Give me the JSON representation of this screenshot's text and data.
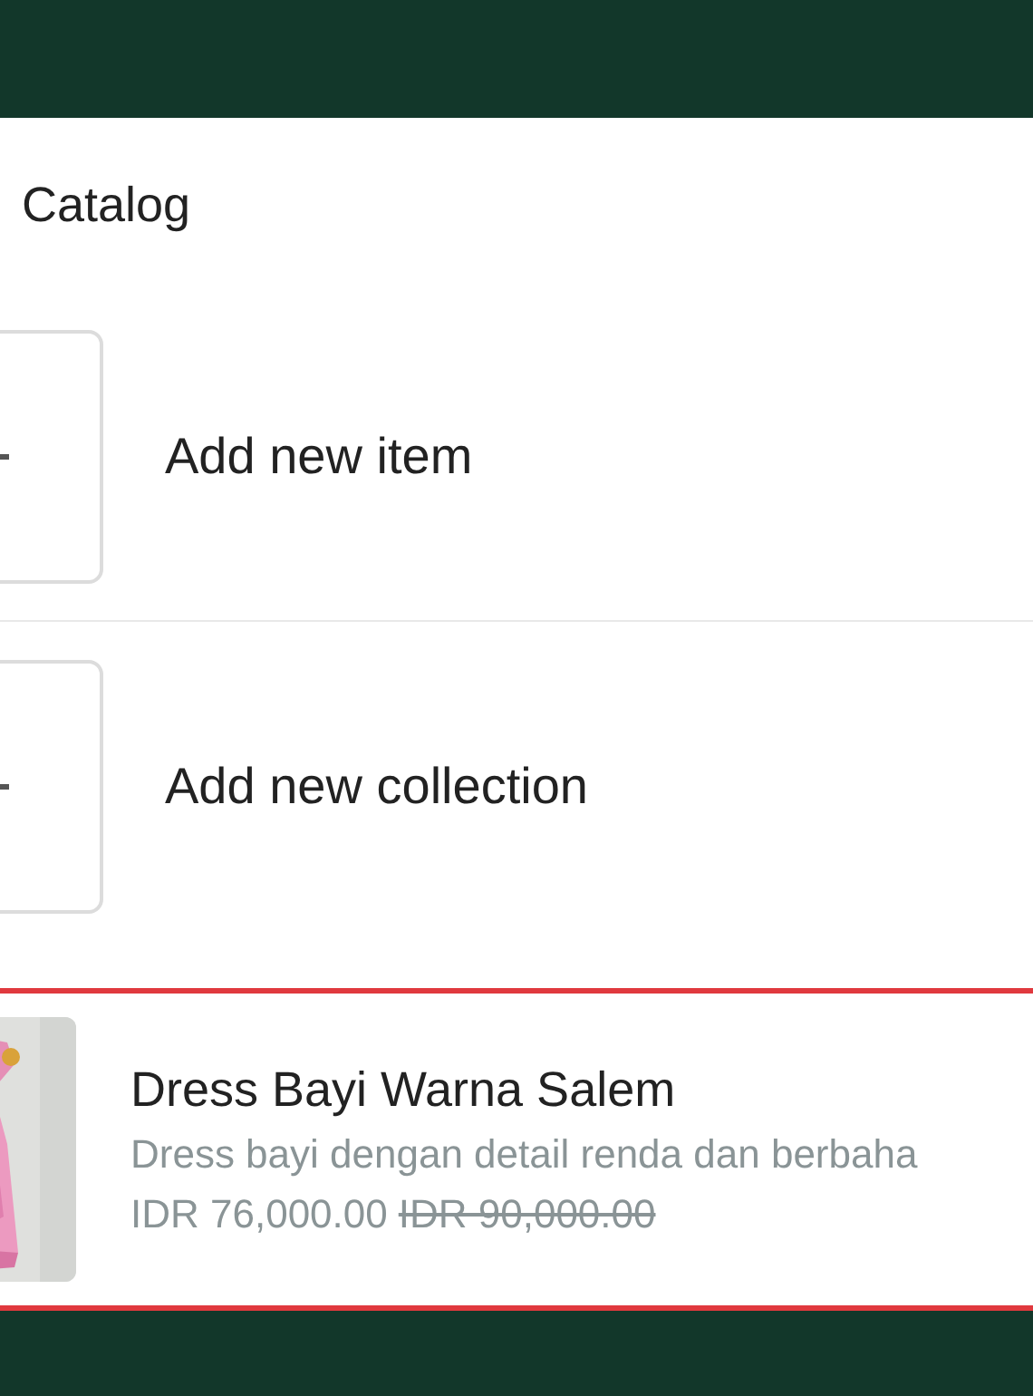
{
  "header": {
    "title": "Catalog"
  },
  "actions": [
    {
      "label": "Add new item"
    },
    {
      "label": "Add new collection"
    }
  ],
  "products": [
    {
      "title": "Dress Bayi Warna Salem",
      "description": "Dress bayi dengan detail renda dan berbaha",
      "price": "IDR 76,000.00",
      "original_price": "IDR 90,000.00",
      "selected": true
    }
  ]
}
